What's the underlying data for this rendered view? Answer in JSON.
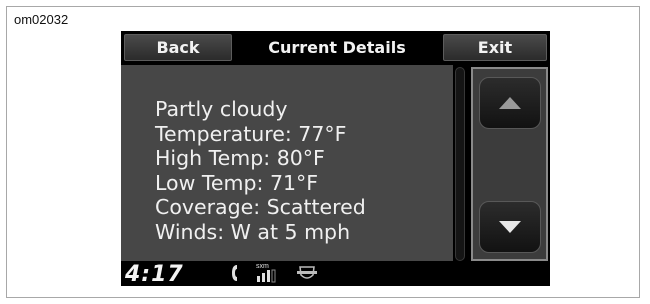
{
  "figure_id": "om02032",
  "header": {
    "back_label": "Back",
    "title": "Current Details",
    "exit_label": "Exit"
  },
  "details": [
    "Partly cloudy",
    "Temperature: 77°F",
    "High Temp: 80°F",
    "Low Temp: 71°F",
    "Coverage: Scattered",
    "Winds: W at 5 mph"
  ],
  "status_bar": {
    "time": "4:17",
    "signal_label": "sxm",
    "icons": [
      "phone-icon",
      "sxm-signal-icon",
      "bar-and-shield-logo-icon"
    ]
  }
}
